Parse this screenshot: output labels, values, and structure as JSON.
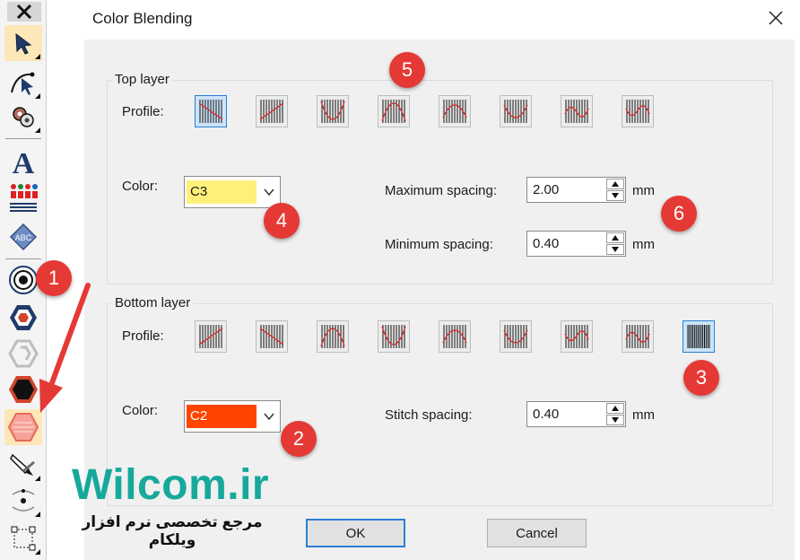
{
  "dialog": {
    "title": "Color Blending",
    "ok_label": "OK",
    "cancel_label": "Cancel"
  },
  "top_layer": {
    "group_title": "Top layer",
    "profile_label": "Profile:",
    "selected_profile_index": 0,
    "color_label": "Color:",
    "color_value": "C3",
    "color_hex": "#fff07a",
    "max_spacing_label": "Maximum spacing:",
    "max_spacing_value": "2.00",
    "min_spacing_label": "Minimum spacing:",
    "min_spacing_value": "0.40",
    "unit": "mm"
  },
  "bottom_layer": {
    "group_title": "Bottom layer",
    "profile_label": "Profile:",
    "selected_profile_index": 8,
    "color_label": "Color:",
    "color_value": "C2",
    "color_hex": "#ff4400",
    "stitch_spacing_label": "Stitch spacing:",
    "stitch_spacing_value": "0.40",
    "unit": "mm"
  },
  "badges": [
    "1",
    "2",
    "3",
    "4",
    "5",
    "6"
  ],
  "watermark": {
    "brand": "Wilcom.ir",
    "subtitle": "مرجع تخصصی نرم افزار ویلکام"
  },
  "toolbar": {
    "icons": [
      "close-icon",
      "select-arrow-icon",
      "reshape-node-icon",
      "stitch-player-icon",
      "lettering-icon",
      "team-names-icon",
      "monogram-icon",
      "target-circle-icon",
      "hexagon-outline-icon",
      "hexagon-gray-icon",
      "hexagon-black-icon",
      "color-blending-icon",
      "pencil-knife-icon",
      "node-shape-icon",
      "bounding-box-icon"
    ]
  },
  "colors": {
    "accent": "#2a7fd4",
    "badge": "#e53935",
    "brand": "#16a99b",
    "active_tool": "#fde7b9",
    "stitch_red": "#d4282a"
  }
}
